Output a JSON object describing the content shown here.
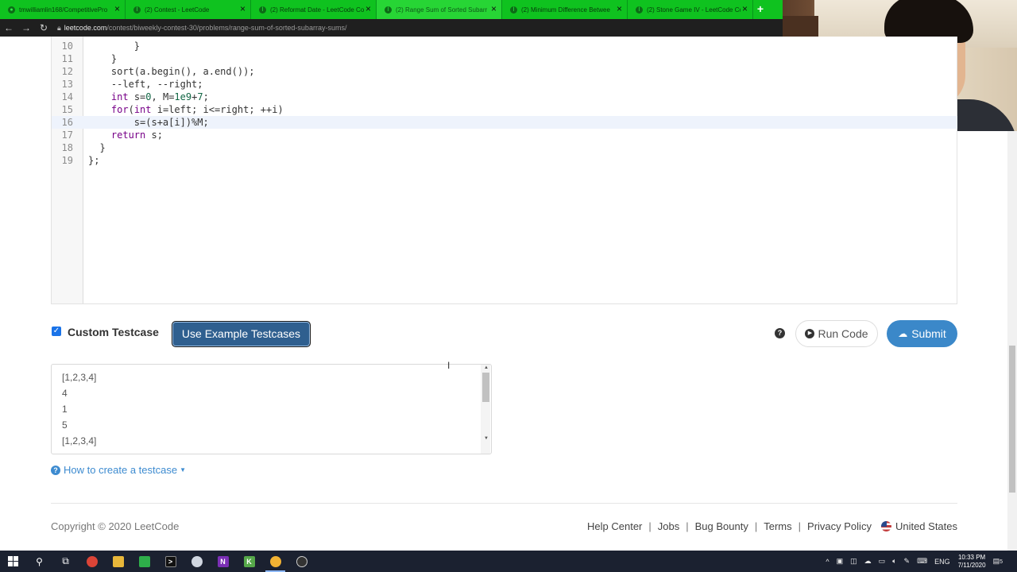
{
  "browser": {
    "tabs": [
      {
        "label": "tmwilliamlin168/CompetitivePro",
        "active": false
      },
      {
        "label": "(2) Contest - LeetCode",
        "active": false
      },
      {
        "label": "(2) Reformat Date - LeetCode Co",
        "active": false
      },
      {
        "label": "(2) Range Sum of Sorted Subarr",
        "active": true
      },
      {
        "label": "(2) Minimum Difference Betwee",
        "active": false
      },
      {
        "label": "(2) Stone Game IV - LeetCode Co",
        "active": false
      }
    ],
    "new_tab_label": "+",
    "url_domain": "leetcode.com",
    "url_path": "/contest/biweekly-contest-30/problems/range-sum-of-sorted-subarray-sums/"
  },
  "editor": {
    "lines": [
      {
        "num": "10",
        "code": "        }"
      },
      {
        "num": "11",
        "code": "    }"
      },
      {
        "num": "12",
        "code": "    sort(a.begin(), a.end());"
      },
      {
        "num": "13",
        "code": "    --left, --right;"
      },
      {
        "num": "14",
        "code": "    int s=0, M=1e9+7;"
      },
      {
        "num": "15",
        "code": "    for(int i=left; i<=right; ++i)"
      },
      {
        "num": "16",
        "code": "        s=(s+a[i])%M;"
      },
      {
        "num": "17",
        "code": "    return s;"
      },
      {
        "num": "18",
        "code": "  }"
      },
      {
        "num": "19",
        "code": "};"
      }
    ],
    "current_line": "16"
  },
  "controls": {
    "custom_testcase_label": "Custom Testcase",
    "custom_testcase_checked": true,
    "use_example_label": "Use Example Testcases",
    "run_label": "Run Code",
    "submit_label": "Submit"
  },
  "testcase": {
    "lines": [
      "[1,2,3,4]",
      "4",
      "1",
      "5",
      "[1,2,3,4]"
    ]
  },
  "howto_label": "How to create a testcase",
  "footer": {
    "copyright": "Copyright © 2020 LeetCode",
    "links": [
      "Help Center",
      "Jobs",
      "Bug Bounty",
      "Terms",
      "Privacy Policy"
    ],
    "region": "United States"
  },
  "taskbar": {
    "lang": "ENG",
    "time": "10:33 PM",
    "date": "7/11/2020",
    "notif_count": "5"
  }
}
